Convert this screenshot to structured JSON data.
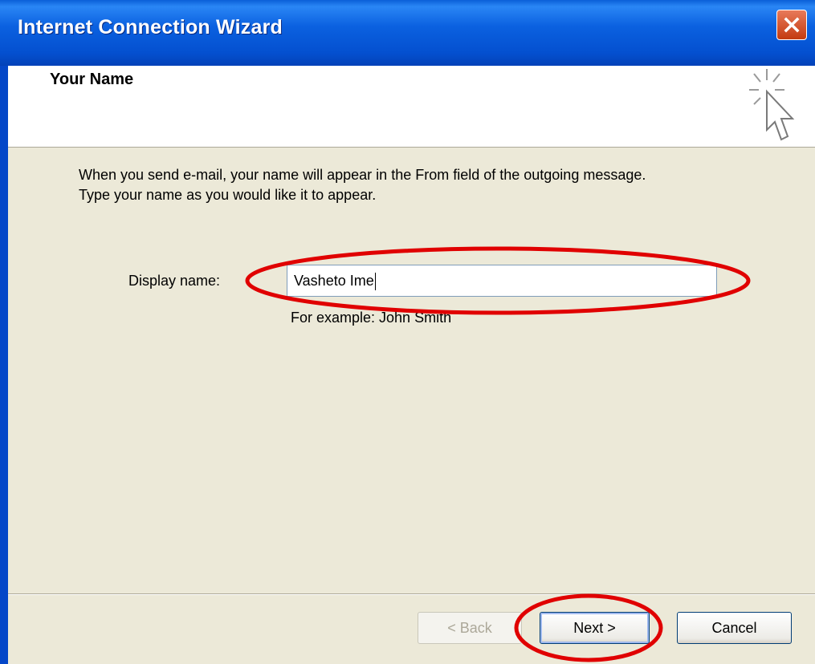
{
  "window": {
    "title": "Internet Connection Wizard",
    "accent_color": "#0450d0"
  },
  "page": {
    "heading": "Your Name",
    "description": "When you send e-mail, your name will appear in the From field of the outgoing message.\nType your name as you would like it to appear."
  },
  "form": {
    "display_name_label": "Display name:",
    "display_name_value": "Vasheto Ime",
    "example_text": "For example: John Smith"
  },
  "buttons": {
    "back": "< Back",
    "next": "Next >",
    "cancel": "Cancel"
  },
  "annotations": {
    "color": "#e00000",
    "highlighted": [
      "display-name-field",
      "next-button"
    ]
  },
  "icons": {
    "close": "close-icon",
    "wizard": "wizard-cursor-icon"
  }
}
